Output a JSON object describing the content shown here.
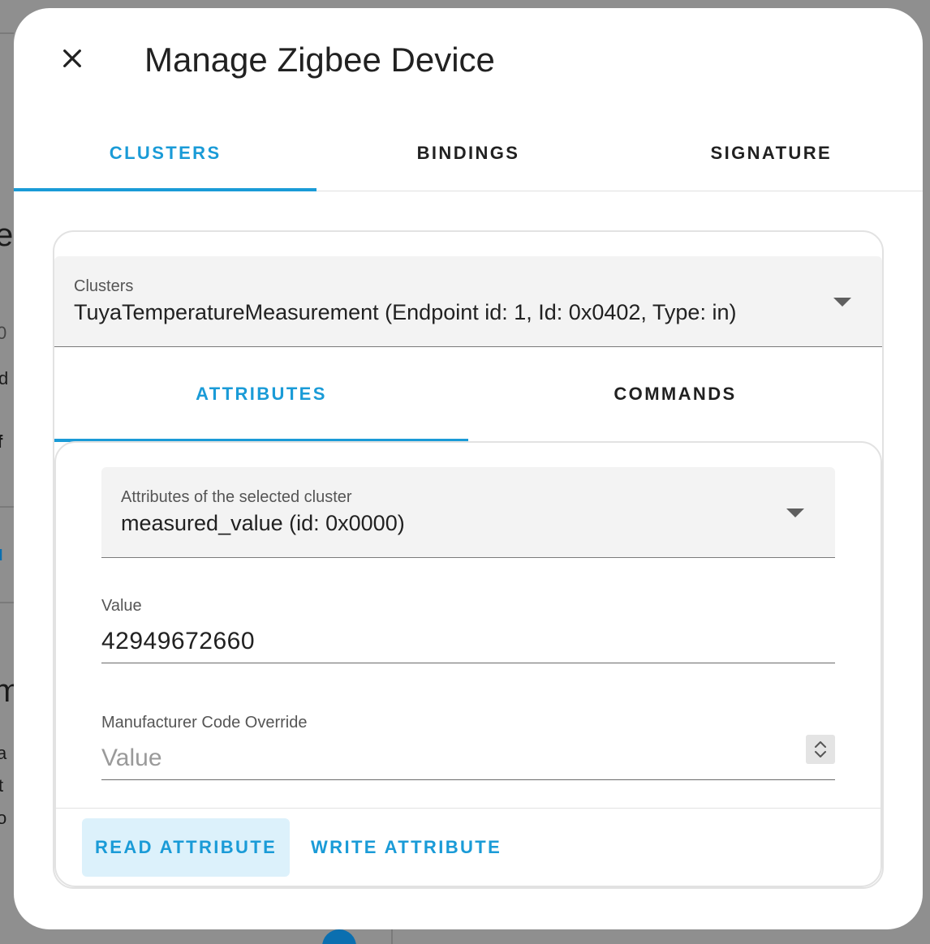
{
  "dialog": {
    "title": "Manage Zigbee Device",
    "tabs": [
      {
        "label": "CLUSTERS",
        "active": true
      },
      {
        "label": "BINDINGS",
        "active": false
      },
      {
        "label": "SIGNATURE",
        "active": false
      }
    ]
  },
  "clusters_select": {
    "label": "Clusters",
    "value": "TuyaTemperatureMeasurement (Endpoint id: 1, Id: 0x0402, Type: in)"
  },
  "cluster_tabs": [
    {
      "label": "ATTRIBUTES",
      "active": true
    },
    {
      "label": "COMMANDS",
      "active": false
    }
  ],
  "attributes_select": {
    "label": "Attributes of the selected cluster",
    "value": "measured_value (id: 0x0000)"
  },
  "value_field": {
    "label": "Value",
    "value": "42949672660"
  },
  "manufacturer_field": {
    "label": "Manufacturer Code Override",
    "placeholder": "Value"
  },
  "actions": {
    "read": "READ ATTRIBUTE",
    "write": "WRITE ATTRIBUTE"
  },
  "colors": {
    "accent": "#1a9bd7",
    "primary_button_bg": "#dcf1fb",
    "scrim": "#8f8f8f"
  },
  "icons": [
    "close-icon",
    "dropdown-arrow-icon",
    "spinner-icon"
  ]
}
